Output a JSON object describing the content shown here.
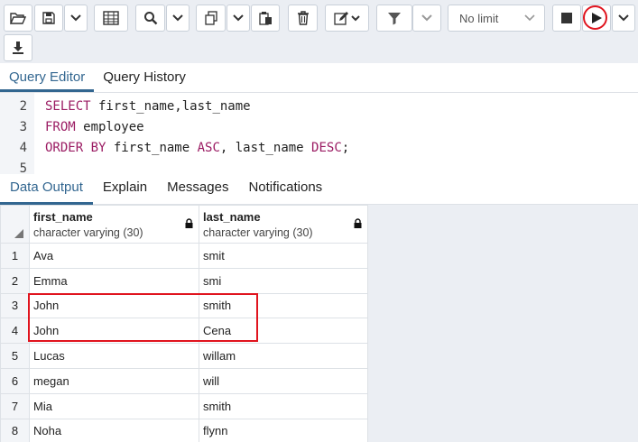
{
  "toolbar": {
    "buttons": [
      {
        "name": "open-file",
        "icon": "folder-open-icon"
      },
      {
        "name": "save",
        "icon": "save-icon"
      },
      {
        "name": "save-dropdown",
        "icon": "chevron-down-icon"
      },
      {
        "name": "edit-grid",
        "icon": "grid-icon"
      },
      {
        "name": "find",
        "icon": "search-icon"
      },
      {
        "name": "find-dropdown",
        "icon": "chevron-down-icon"
      },
      {
        "name": "copy",
        "icon": "copy-icon"
      },
      {
        "name": "copy-dropdown",
        "icon": "chevron-down-icon"
      },
      {
        "name": "paste",
        "icon": "paste-icon"
      },
      {
        "name": "delete",
        "icon": "trash-icon"
      },
      {
        "name": "edit",
        "icon": "pencil-icon"
      },
      {
        "name": "filter",
        "icon": "filter-icon"
      },
      {
        "name": "filter-dropdown",
        "icon": "chevron-down-icon"
      },
      {
        "name": "stop",
        "icon": "stop-icon"
      },
      {
        "name": "execute",
        "icon": "play-icon"
      },
      {
        "name": "execute-dropdown",
        "icon": "chevron-down-icon"
      },
      {
        "name": "download",
        "icon": "download-icon"
      }
    ],
    "limit_label": "No limit"
  },
  "editor_tabs": [
    "Query Editor",
    "Query History"
  ],
  "editor_lines": [
    {
      "num": "2",
      "parts": [
        {
          "t": "SELECT",
          "kw": true
        },
        {
          "t": " first_name,last_name",
          "kw": false
        }
      ]
    },
    {
      "num": "3",
      "parts": [
        {
          "t": "FROM",
          "kw": true
        },
        {
          "t": " employee",
          "kw": false
        }
      ]
    },
    {
      "num": "4",
      "parts": [
        {
          "t": "ORDER BY",
          "kw": true
        },
        {
          "t": " first_name ",
          "kw": false
        },
        {
          "t": "ASC",
          "kw": true
        },
        {
          "t": ", last_name ",
          "kw": false
        },
        {
          "t": "DESC",
          "kw": true
        },
        {
          "t": ";",
          "kw": false
        }
      ]
    },
    {
      "num": "5",
      "parts": []
    }
  ],
  "output_tabs": [
    "Data Output",
    "Explain",
    "Messages",
    "Notifications"
  ],
  "grid": {
    "columns": [
      {
        "name": "first_name",
        "type": "character varying (30)"
      },
      {
        "name": "last_name",
        "type": "character varying (30)"
      }
    ],
    "rows": [
      {
        "num": "1",
        "first_name": "Ava",
        "last_name": "smit"
      },
      {
        "num": "2",
        "first_name": "Emma",
        "last_name": "smi"
      },
      {
        "num": "3",
        "first_name": "John",
        "last_name": "smith"
      },
      {
        "num": "4",
        "first_name": "John",
        "last_name": "Cena"
      },
      {
        "num": "5",
        "first_name": "Lucas",
        "last_name": "willam"
      },
      {
        "num": "6",
        "first_name": "megan",
        "last_name": "will"
      },
      {
        "num": "7",
        "first_name": "Mia",
        "last_name": "smith"
      },
      {
        "num": "8",
        "first_name": "Noha",
        "last_name": "flynn"
      }
    ]
  },
  "colors": {
    "accent": "#326690",
    "keyword": "#9b1c63",
    "highlight": "#e0141e"
  }
}
